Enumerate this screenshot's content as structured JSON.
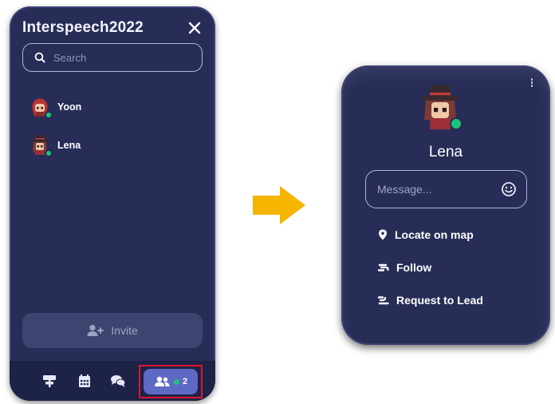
{
  "left_panel": {
    "title": "Interspeech2022",
    "search_placeholder": "Search",
    "members": [
      {
        "name": "Yoon",
        "status": "online"
      },
      {
        "name": "Lena",
        "status": "online"
      }
    ],
    "invite_label": "Invite",
    "bottom_bar": {
      "icons": [
        "signpost-icon",
        "calendar-icon",
        "chat-icon",
        "members-icon"
      ],
      "online_count": "2"
    }
  },
  "profile_popup": {
    "name": "Lena",
    "message_placeholder": "Message...",
    "actions": [
      {
        "icon": "location-pin-icon",
        "label": "Locate on map"
      },
      {
        "icon": "follow-icon",
        "label": "Follow"
      },
      {
        "icon": "lead-icon",
        "label": "Request to Lead"
      }
    ]
  },
  "colors": {
    "panel_bg": "#272d57",
    "bottom_bar_bg": "#1d2247",
    "active_tab": "#5e69c4",
    "online": "#19c47a",
    "highlight_box": "#e0152a",
    "arrow": "#f5b400"
  }
}
